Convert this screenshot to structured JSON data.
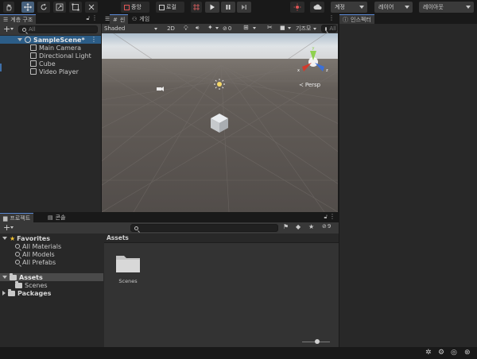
{
  "toolbar": {
    "tools": [
      "hand-icon",
      "move-icon",
      "rotate-icon",
      "scale-icon",
      "rect-icon",
      "transform-icon"
    ],
    "center_label": "중앙",
    "local_label": "로컬",
    "account_label": "계정",
    "layers_label": "레이어",
    "layout_label": "레이아웃"
  },
  "hierarchy": {
    "tab_label": "계층 구조",
    "search_placeholder": "All",
    "scene_name": "SampleScene*",
    "items": [
      "Main Camera",
      "Directional Light",
      "Cube",
      "Video Player"
    ]
  },
  "scene": {
    "tab_scene": "씬",
    "tab_game": "게임",
    "shading_mode": "Shaded",
    "mode_2d": "2D",
    "hidden_count": "0",
    "gizmos_label": "기즈모",
    "search_placeholder": "All",
    "persp_label": "Persp"
  },
  "inspector": {
    "tab_label": "인스펙터"
  },
  "project": {
    "tab_project": "프로젝트",
    "tab_console": "콘솔",
    "hidden_count": "9",
    "favorites_label": "Favorites",
    "favorites": [
      "All Materials",
      "All Models",
      "All Prefabs"
    ],
    "assets_label": "Assets",
    "assets_children": [
      "Scenes"
    ],
    "packages_label": "Packages",
    "breadcrumb": "Assets",
    "grid_items": [
      "Scenes"
    ]
  },
  "colors": {
    "accent": "#2c5d87",
    "tab_highlight": "#5b8ad6",
    "play_active": "#46607c",
    "gizmo_x": "#d23a2c",
    "gizmo_y": "#8fd14f",
    "gizmo_z": "#3b6fd6",
    "scene_sky_top": "#cfd6dd",
    "scene_ground": "#5a5552"
  }
}
